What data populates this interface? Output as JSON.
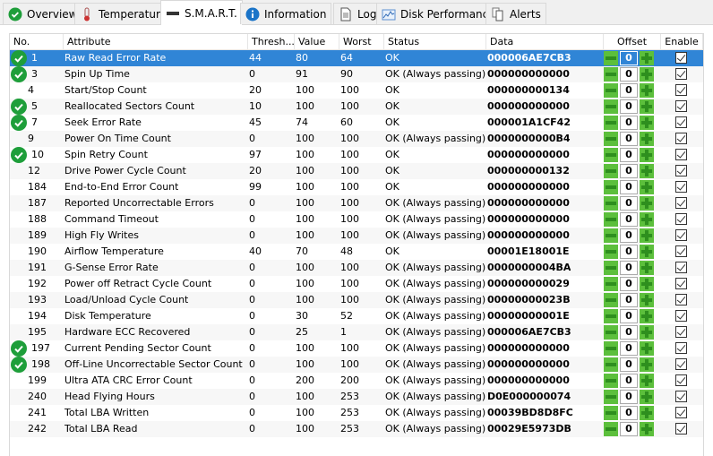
{
  "tabs": [
    {
      "label": "Overview",
      "icon": "check-circle-icon"
    },
    {
      "label": "Temperature",
      "icon": "thermometer-icon"
    },
    {
      "label": "S.M.A.R.T.",
      "icon": "smart-bar-icon",
      "active": true
    },
    {
      "label": "Information",
      "icon": "info-icon"
    },
    {
      "label": "Log",
      "icon": "document-icon"
    },
    {
      "label": "Disk Performance",
      "icon": "chart-icon"
    },
    {
      "label": "Alerts",
      "icon": "documents-icon"
    }
  ],
  "columns": [
    "No.",
    "Attribute",
    "Thresh...",
    "Value",
    "Worst",
    "Status",
    "Data",
    "Offset",
    "Enable"
  ],
  "rows": [
    {
      "no": "1",
      "attr": "Raw Read Error Rate",
      "thresh": "44",
      "value": "80",
      "worst": "64",
      "status": "OK",
      "data": "000006AE7CB3",
      "ok_icon": true,
      "offset": "0",
      "enabled": true,
      "selected": true
    },
    {
      "no": "3",
      "attr": "Spin Up Time",
      "thresh": "0",
      "value": "91",
      "worst": "90",
      "status": "OK (Always passing)",
      "data": "000000000000",
      "ok_icon": true,
      "offset": "0",
      "enabled": true
    },
    {
      "no": "4",
      "attr": "Start/Stop Count",
      "thresh": "20",
      "value": "100",
      "worst": "100",
      "status": "OK",
      "data": "000000000134",
      "ok_icon": false,
      "offset": "0",
      "enabled": true
    },
    {
      "no": "5",
      "attr": "Reallocated Sectors Count",
      "thresh": "10",
      "value": "100",
      "worst": "100",
      "status": "OK",
      "data": "000000000000",
      "ok_icon": true,
      "offset": "0",
      "enabled": true
    },
    {
      "no": "7",
      "attr": "Seek Error Rate",
      "thresh": "45",
      "value": "74",
      "worst": "60",
      "status": "OK",
      "data": "000001A1CF42",
      "ok_icon": true,
      "offset": "0",
      "enabled": true
    },
    {
      "no": "9",
      "attr": "Power On Time Count",
      "thresh": "0",
      "value": "100",
      "worst": "100",
      "status": "OK (Always passing)",
      "data": "0000000000B4",
      "ok_icon": false,
      "offset": "0",
      "enabled": true
    },
    {
      "no": "10",
      "attr": "Spin Retry Count",
      "thresh": "97",
      "value": "100",
      "worst": "100",
      "status": "OK",
      "data": "000000000000",
      "ok_icon": true,
      "offset": "0",
      "enabled": true
    },
    {
      "no": "12",
      "attr": "Drive Power Cycle Count",
      "thresh": "20",
      "value": "100",
      "worst": "100",
      "status": "OK",
      "data": "000000000132",
      "ok_icon": false,
      "offset": "0",
      "enabled": true
    },
    {
      "no": "184",
      "attr": "End-to-End Error Count",
      "thresh": "99",
      "value": "100",
      "worst": "100",
      "status": "OK",
      "data": "000000000000",
      "ok_icon": false,
      "offset": "0",
      "enabled": true
    },
    {
      "no": "187",
      "attr": "Reported Uncorrectable Errors",
      "thresh": "0",
      "value": "100",
      "worst": "100",
      "status": "OK (Always passing)",
      "data": "000000000000",
      "ok_icon": false,
      "offset": "0",
      "enabled": true
    },
    {
      "no": "188",
      "attr": "Command Timeout",
      "thresh": "0",
      "value": "100",
      "worst": "100",
      "status": "OK (Always passing)",
      "data": "000000000000",
      "ok_icon": false,
      "offset": "0",
      "enabled": true
    },
    {
      "no": "189",
      "attr": "High Fly Writes",
      "thresh": "0",
      "value": "100",
      "worst": "100",
      "status": "OK (Always passing)",
      "data": "000000000000",
      "ok_icon": false,
      "offset": "0",
      "enabled": true
    },
    {
      "no": "190",
      "attr": "Airflow Temperature",
      "thresh": "40",
      "value": "70",
      "worst": "48",
      "status": "OK",
      "data": "00001E18001E",
      "ok_icon": false,
      "offset": "0",
      "enabled": true
    },
    {
      "no": "191",
      "attr": "G-Sense Error Rate",
      "thresh": "0",
      "value": "100",
      "worst": "100",
      "status": "OK (Always passing)",
      "data": "0000000004BA",
      "ok_icon": false,
      "offset": "0",
      "enabled": true
    },
    {
      "no": "192",
      "attr": "Power off Retract Cycle Count",
      "thresh": "0",
      "value": "100",
      "worst": "100",
      "status": "OK (Always passing)",
      "data": "000000000029",
      "ok_icon": false,
      "offset": "0",
      "enabled": true
    },
    {
      "no": "193",
      "attr": "Load/Unload Cycle Count",
      "thresh": "0",
      "value": "100",
      "worst": "100",
      "status": "OK (Always passing)",
      "data": "00000000023B",
      "ok_icon": false,
      "offset": "0",
      "enabled": true
    },
    {
      "no": "194",
      "attr": "Disk Temperature",
      "thresh": "0",
      "value": "30",
      "worst": "52",
      "status": "OK (Always passing)",
      "data": "00000000001E",
      "ok_icon": false,
      "offset": "0",
      "enabled": true
    },
    {
      "no": "195",
      "attr": "Hardware ECC Recovered",
      "thresh": "0",
      "value": "25",
      "worst": "1",
      "status": "OK (Always passing)",
      "data": "000006AE7CB3",
      "ok_icon": false,
      "offset": "0",
      "enabled": true
    },
    {
      "no": "197",
      "attr": "Current Pending Sector Count",
      "thresh": "0",
      "value": "100",
      "worst": "100",
      "status": "OK (Always passing)",
      "data": "000000000000",
      "ok_icon": true,
      "offset": "0",
      "enabled": true
    },
    {
      "no": "198",
      "attr": "Off-Line Uncorrectable Sector Count",
      "thresh": "0",
      "value": "100",
      "worst": "100",
      "status": "OK (Always passing)",
      "data": "000000000000",
      "ok_icon": true,
      "offset": "0",
      "enabled": true
    },
    {
      "no": "199",
      "attr": "Ultra ATA CRC Error Count",
      "thresh": "0",
      "value": "200",
      "worst": "200",
      "status": "OK (Always passing)",
      "data": "000000000000",
      "ok_icon": false,
      "offset": "0",
      "enabled": true
    },
    {
      "no": "240",
      "attr": "Head Flying Hours",
      "thresh": "0",
      "value": "100",
      "worst": "253",
      "status": "OK (Always passing)",
      "data": "D0E000000074",
      "ok_icon": false,
      "offset": "0",
      "enabled": true
    },
    {
      "no": "241",
      "attr": "Total LBA Written",
      "thresh": "0",
      "value": "100",
      "worst": "253",
      "status": "OK (Always passing)",
      "data": "00039BD8D8FC",
      "ok_icon": false,
      "offset": "0",
      "enabled": true
    },
    {
      "no": "242",
      "attr": "Total LBA Read",
      "thresh": "0",
      "value": "100",
      "worst": "253",
      "status": "OK (Always passing)",
      "data": "00029E5973DB",
      "ok_icon": false,
      "offset": "0",
      "enabled": true
    }
  ],
  "colors": {
    "selection": "#3085d6",
    "ok_green": "#1e9e3a",
    "offset_green": "#5cbf3c"
  }
}
